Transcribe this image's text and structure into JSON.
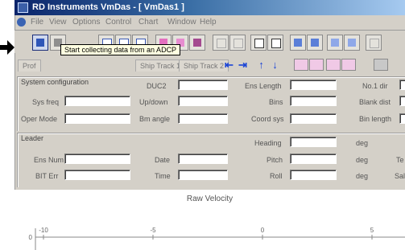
{
  "window": {
    "title": "RD Instruments VmDas - [ VmDas1 ]"
  },
  "menu": {
    "items": [
      "File",
      "View",
      "Options",
      "Control",
      "Chart",
      "Window",
      "Help"
    ]
  },
  "toolbar": {
    "tooltip": "Start collecting data from an ADCP"
  },
  "tabs": {
    "items": [
      "Prof",
      "Ship Track 1",
      "Ship Track 2"
    ]
  },
  "system_config": {
    "title": "System configuration",
    "fields": {
      "sys_freq": "Sys freq",
      "dual": "DUC2",
      "ens_length": "Ens Length",
      "no_bins": "No.1 dir",
      "up_down": "Up/down",
      "bins": "Bins",
      "blank": "Blank dist",
      "oper_mode": "Oper Mode",
      "beam_angle": "Bm angle",
      "coord": "Coord sys",
      "bin_length": "Bin length"
    }
  },
  "leader": {
    "title": "Leader",
    "fields": {
      "heading": "Heading",
      "ens_num": "Ens Num",
      "date": "Date",
      "pitch": "Pitch",
      "bit_err": "BIT Err",
      "time": "Time",
      "roll": "Roll",
      "unit": "deg",
      "right_a": "Te",
      "right_b": "Sal"
    }
  },
  "chart_data": {
    "type": "line",
    "title": "Raw Velocity",
    "x_ticks": [
      "-10",
      "-5",
      "0",
      "5"
    ],
    "y_ticks": [
      "0"
    ],
    "series": []
  }
}
